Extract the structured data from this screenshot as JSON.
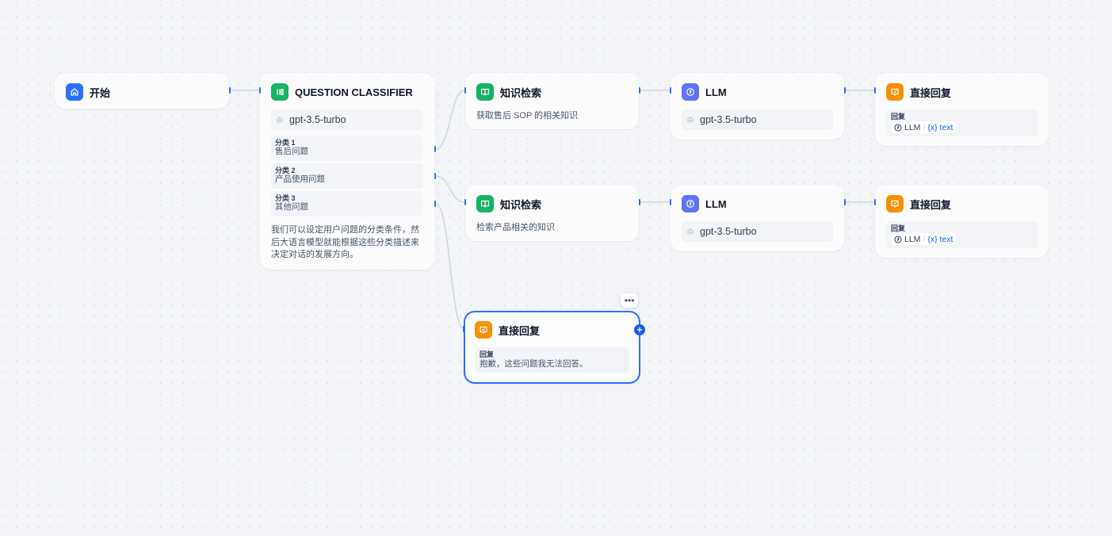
{
  "nodes": {
    "start": {
      "title": "开始"
    },
    "classifier": {
      "title": "QUESTION CLASSIFIER",
      "model": "gpt-3.5-turbo",
      "classes": [
        {
          "key": "分类 1",
          "value": "售后问题"
        },
        {
          "key": "分类 2",
          "value": "产品使用问题"
        },
        {
          "key": "分类 3",
          "value": "其他问题"
        }
      ],
      "description": "我们可以设定用户问题的分类条件，然后大语言模型就能根据这些分类描述来决定对话的发展方向。"
    },
    "kr1": {
      "title": "知识检索",
      "description": "获取售后 SOP 的相关知识"
    },
    "kr2": {
      "title": "知识检索",
      "description": "检索产品相关的知识"
    },
    "llm1": {
      "title": "LLM",
      "model": "gpt-3.5-turbo"
    },
    "llm2": {
      "title": "LLM",
      "model": "gpt-3.5-turbo"
    },
    "answer1": {
      "title": "直接回复",
      "reply_label": "回复",
      "var_node": "LLM",
      "var_sep": "/",
      "var_name": "{x} text"
    },
    "answer2": {
      "title": "直接回复",
      "reply_label": "回复",
      "var_node": "LLM",
      "var_sep": "/",
      "var_name": "{x} text"
    },
    "answer3": {
      "title": "直接回复",
      "reply_label": "回复",
      "reply_text": "抱歉，这些问题我无法回答。"
    }
  },
  "controls": {
    "more": "•••",
    "add": "+"
  },
  "colors": {
    "accent": "#2970ff",
    "start": "#2970ff",
    "classifier": "#16b364",
    "knowledge": "#16b364",
    "llm": "#6172f3",
    "answer": "#f79009"
  },
  "icons": {
    "start": "home-icon",
    "classifier": "classifier-icon",
    "knowledge": "book-icon",
    "llm": "llm-icon",
    "answer": "answer-icon",
    "model": "cube-icon"
  }
}
